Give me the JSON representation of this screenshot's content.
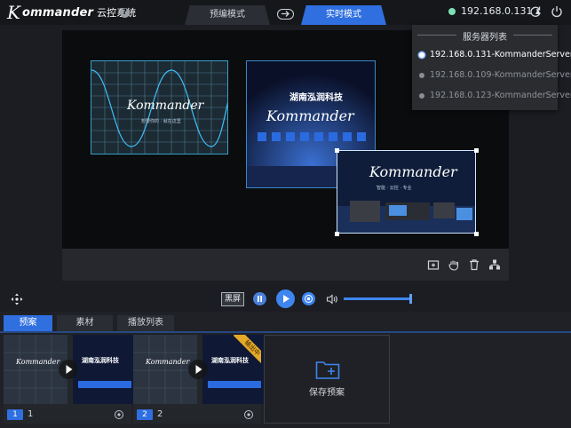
{
  "header": {
    "logo_k": "K",
    "logo_brand": "ommander",
    "logo_suffix": "云控系统",
    "help_label": "?",
    "tabs": [
      {
        "label": "预编模式",
        "active": false
      },
      {
        "label": "实时模式",
        "active": true
      }
    ],
    "server_ip": "192.168.0.131 ▴",
    "server_status_color": "#7fe0b8",
    "icons": {
      "switch": "switch-mode-icon",
      "refresh": "refresh-icon",
      "power": "power-icon"
    }
  },
  "server_menu": {
    "title": "服务器列表",
    "items": [
      {
        "label": "192.168.0.131-KommanderServer",
        "selected": true
      },
      {
        "label": "192.168.0.109-KommanderServer",
        "selected": false
      },
      {
        "label": "192.168.0.123-KommanderServer",
        "selected": false
      }
    ]
  },
  "stage": {
    "media": [
      {
        "caption": "Kommander",
        "subcaption": "想要你的 · 就在这里"
      },
      {
        "caption": "湖南泓润科技",
        "subcaption": "Kommander"
      },
      {
        "caption": "Kommander",
        "subcaption": "智能 · 云控 · 专业"
      }
    ],
    "toolbar_icons": [
      "add-layer-icon",
      "hand-icon",
      "delete-icon",
      "split-icon"
    ]
  },
  "playback": {
    "blackout_label": "黑屏",
    "volume_percent": 100,
    "accent": "#3f85f0"
  },
  "bottom": {
    "tabs": [
      {
        "label": "预案",
        "active": true
      },
      {
        "label": "素材",
        "active": false
      },
      {
        "label": "播放列表",
        "active": false
      }
    ],
    "presets": [
      {
        "number": "1",
        "name": "1",
        "thumb_a": "Kommander",
        "thumb_b": "湖南泓润科技",
        "playing": false
      },
      {
        "number": "2",
        "name": "2",
        "thumb_a": "Kommander",
        "thumb_b": "湖南泓润科技",
        "playing": true,
        "badge": "输出中"
      }
    ],
    "save_label": "保存预案"
  }
}
